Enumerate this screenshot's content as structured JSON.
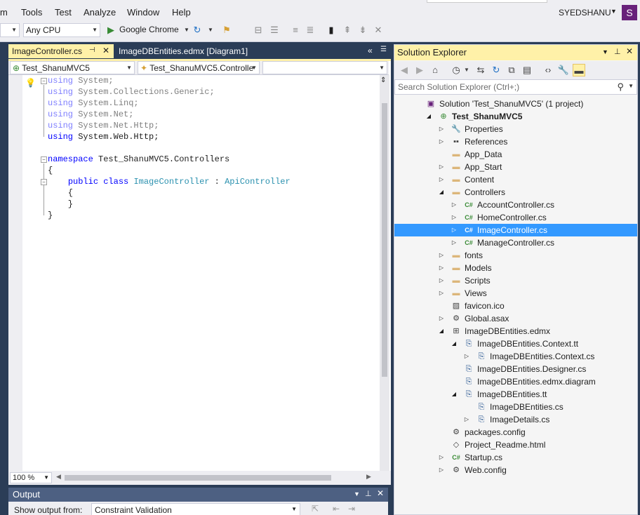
{
  "menu": [
    "m",
    "Tools",
    "Test",
    "Analyze",
    "Window",
    "Help"
  ],
  "user": {
    "name": "SYEDSHANU",
    "badge": "S"
  },
  "toolbar": {
    "config_value": "",
    "platform_value": "Any CPU",
    "run_label": "Google Chrome"
  },
  "doc_tabs": {
    "active": "ImageController.cs",
    "inactive": "ImageDBEntities.edmx [Diagram1]"
  },
  "editor": {
    "project_combo": "Test_ShanuMVC5",
    "class_combo": "Test_ShanuMVC5.Controlle",
    "member_combo": "",
    "zoom": "100 %",
    "code": [
      {
        "parts": [
          {
            "t": "using",
            "c": "kw-dim"
          },
          {
            "t": " System;",
            "c": "gray"
          }
        ]
      },
      {
        "parts": [
          {
            "t": "using",
            "c": "kw-dim"
          },
          {
            "t": " System.Collections.Generic;",
            "c": "gray"
          }
        ]
      },
      {
        "parts": [
          {
            "t": "using",
            "c": "kw-dim"
          },
          {
            "t": " System.Linq;",
            "c": "gray"
          }
        ]
      },
      {
        "parts": [
          {
            "t": "using",
            "c": "kw-dim"
          },
          {
            "t": " System.Net;",
            "c": "gray"
          }
        ]
      },
      {
        "parts": [
          {
            "t": "using",
            "c": "kw-dim"
          },
          {
            "t": " System.Net.Http;",
            "c": "gray"
          }
        ]
      },
      {
        "parts": [
          {
            "t": "using",
            "c": "kw"
          },
          {
            "t": " System.Web.Http;",
            "c": ""
          }
        ]
      },
      {
        "parts": []
      },
      {
        "parts": [
          {
            "t": "namespace",
            "c": "kw"
          },
          {
            "t": " Test_ShanuMVC5.Controllers",
            "c": ""
          }
        ]
      },
      {
        "parts": [
          {
            "t": "{",
            "c": ""
          }
        ]
      },
      {
        "parts": [
          {
            "t": "    ",
            "c": ""
          },
          {
            "t": "public",
            "c": "kw"
          },
          {
            "t": " ",
            "c": ""
          },
          {
            "t": "class",
            "c": "kw"
          },
          {
            "t": " ",
            "c": ""
          },
          {
            "t": "ImageController",
            "c": "type"
          },
          {
            "t": " : ",
            "c": ""
          },
          {
            "t": "ApiController",
            "c": "type"
          }
        ]
      },
      {
        "parts": [
          {
            "t": "    {",
            "c": ""
          }
        ]
      },
      {
        "parts": [
          {
            "t": "    }",
            "c": ""
          }
        ]
      },
      {
        "parts": [
          {
            "t": "}",
            "c": ""
          }
        ]
      }
    ]
  },
  "output": {
    "title": "Output",
    "show_from_label": "Show output from:",
    "source": "Constraint Validation"
  },
  "solution_explorer": {
    "title": "Solution Explorer",
    "search_placeholder": "Search Solution Explorer (Ctrl+;)",
    "nodes": [
      {
        "label": "Solution 'Test_ShanuMVC5' (1 project)",
        "depth": 0,
        "arrow": "",
        "icon": "solution-icon"
      },
      {
        "label": "Test_ShanuMVC5",
        "depth": 1,
        "arrow": "open",
        "icon": "web-project-icon",
        "bold": true
      },
      {
        "label": "Properties",
        "depth": 2,
        "arrow": "closed",
        "icon": "wrench-icon"
      },
      {
        "label": "References",
        "depth": 2,
        "arrow": "closed",
        "icon": "references-icon"
      },
      {
        "label": "App_Data",
        "depth": 2,
        "arrow": "",
        "icon": "folder-icon"
      },
      {
        "label": "App_Start",
        "depth": 2,
        "arrow": "closed",
        "icon": "folder-icon"
      },
      {
        "label": "Content",
        "depth": 2,
        "arrow": "closed",
        "icon": "folder-icon"
      },
      {
        "label": "Controllers",
        "depth": 2,
        "arrow": "open",
        "icon": "folder-open-icon"
      },
      {
        "label": "AccountController.cs",
        "depth": 3,
        "arrow": "closed",
        "icon": "csharp-file-icon"
      },
      {
        "label": "HomeController.cs",
        "depth": 3,
        "arrow": "closed",
        "icon": "csharp-file-icon"
      },
      {
        "label": "ImageController.cs",
        "depth": 3,
        "arrow": "closed",
        "icon": "csharp-file-icon",
        "selected": true
      },
      {
        "label": "ManageController.cs",
        "depth": 3,
        "arrow": "closed",
        "icon": "csharp-file-icon"
      },
      {
        "label": "fonts",
        "depth": 2,
        "arrow": "closed",
        "icon": "folder-icon"
      },
      {
        "label": "Models",
        "depth": 2,
        "arrow": "closed",
        "icon": "folder-icon"
      },
      {
        "label": "Scripts",
        "depth": 2,
        "arrow": "closed",
        "icon": "folder-icon"
      },
      {
        "label": "Views",
        "depth": 2,
        "arrow": "closed",
        "icon": "folder-icon"
      },
      {
        "label": "favicon.ico",
        "depth": 2,
        "arrow": "",
        "icon": "image-file-icon"
      },
      {
        "label": "Global.asax",
        "depth": 2,
        "arrow": "closed",
        "icon": "asax-file-icon"
      },
      {
        "label": "ImageDBEntities.edmx",
        "depth": 2,
        "arrow": "open",
        "icon": "edmx-file-icon"
      },
      {
        "label": "ImageDBEntities.Context.tt",
        "depth": 3,
        "arrow": "open",
        "icon": "template-file-icon"
      },
      {
        "label": "ImageDBEntities.Context.cs",
        "depth": 4,
        "arrow": "closed",
        "icon": "template-file-icon"
      },
      {
        "label": "ImageDBEntities.Designer.cs",
        "depth": 3,
        "arrow": "",
        "icon": "template-file-icon"
      },
      {
        "label": "ImageDBEntities.edmx.diagram",
        "depth": 3,
        "arrow": "",
        "icon": "template-file-icon"
      },
      {
        "label": "ImageDBEntities.tt",
        "depth": 3,
        "arrow": "open",
        "icon": "template-file-icon"
      },
      {
        "label": "ImageDBEntities.cs",
        "depth": 4,
        "arrow": "",
        "icon": "template-file-icon"
      },
      {
        "label": "ImageDetails.cs",
        "depth": 4,
        "arrow": "closed",
        "icon": "template-file-icon"
      },
      {
        "label": "packages.config",
        "depth": 2,
        "arrow": "",
        "icon": "config-file-icon"
      },
      {
        "label": "Project_Readme.html",
        "depth": 2,
        "arrow": "",
        "icon": "html-file-icon"
      },
      {
        "label": "Startup.cs",
        "depth": 2,
        "arrow": "closed",
        "icon": "csharp-file-icon"
      },
      {
        "label": "Web.config",
        "depth": 2,
        "arrow": "closed",
        "icon": "config-file-icon"
      }
    ]
  },
  "colors": {
    "accent": "#fff1a8",
    "selection": "#3399ff",
    "frame": "#2b3d57",
    "user_badge": "#68217a"
  }
}
